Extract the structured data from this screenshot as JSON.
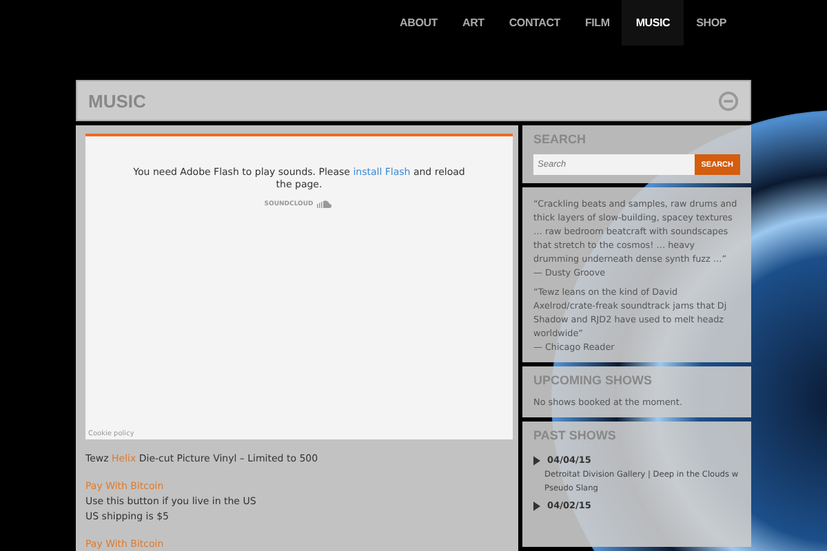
{
  "nav": [
    {
      "label": "ABOUT",
      "selected": false
    },
    {
      "label": "ART",
      "selected": false
    },
    {
      "label": "CONTACT",
      "selected": false
    },
    {
      "label": "FILM",
      "selected": false
    },
    {
      "label": "MUSIC",
      "selected": true
    },
    {
      "label": "SHOP",
      "selected": false
    }
  ],
  "page": {
    "title": "MUSIC"
  },
  "player": {
    "message_before": "You need Adobe Flash to play sounds. Please",
    "link": "install Flash",
    "message_after": "and reload the page.",
    "brand": "SOUNDCLOUD",
    "footer": "Cookie policy"
  },
  "product": {
    "before": "Tewz",
    "link": "Helix",
    "after": "Die-cut Picture Vinyl – Limited to 500"
  },
  "purchase": [
    {
      "link": "Pay With Bitcoin",
      "lines": [
        "Use this button if you live in the US",
        "US shipping is $5"
      ]
    },
    {
      "link": "Pay With Bitcoin"
    }
  ],
  "search": {
    "title": "SEARCH",
    "placeholder": "Search",
    "button": "SEARCH"
  },
  "quotes": [
    {
      "text": "“Crackling beats and samples, raw drums and thick layers of slow-building, spacey textures … raw bedroom beatcraft with soundscapes that stretch to the cosmos! … heavy drumming underneath dense synth fuzz …”",
      "source": "— Dusty Groove"
    },
    {
      "text": "“Tewz leans on the kind of David Axelrod/crate-freak soundtrack jams that Dj Shadow and RJD2 have used to melt headz worldwide”",
      "source": "— Chicago Reader"
    }
  ],
  "upcoming": {
    "title": "UPCOMING SHOWS",
    "message": "No shows booked at the moment."
  },
  "past": {
    "title": "PAST SHOWS",
    "shows": [
      {
        "date": "04/04/15",
        "lines": [
          "Detroitat Division Gallery | Deep in the Clouds w",
          "Pseudo Slang"
        ]
      },
      {
        "date": "04/02/15"
      }
    ]
  }
}
